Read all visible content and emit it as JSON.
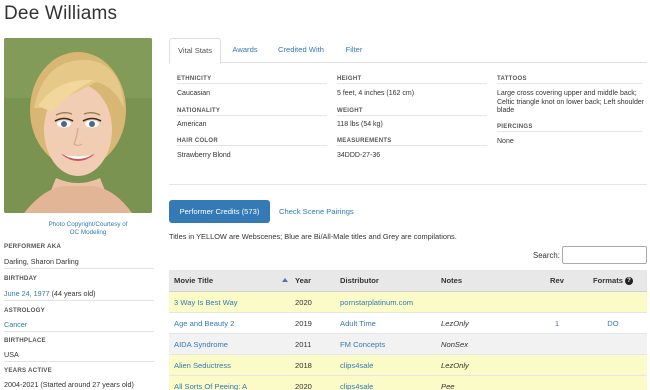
{
  "page": {
    "title": "Dee Williams"
  },
  "photo": {
    "credit_line1": "Photo Copyright/Courtesy of",
    "credit_line2": "OC Modeling"
  },
  "sidebar": [
    {
      "label": "PERFORMER AKA",
      "value": "Darling, Sharon Darling"
    },
    {
      "label": "BIRTHDAY",
      "value_link": "June 24, 1977",
      "value": " (44 years old)"
    },
    {
      "label": "ASTROLOGY",
      "value_link": "Cancer",
      "value": ""
    },
    {
      "label": "BIRTHPLACE",
      "value": "USA"
    },
    {
      "label": "YEARS ACTIVE",
      "value": "2004-2021 (Started around 27 years old)"
    }
  ],
  "tabs": [
    "Vital Stats",
    "Awards",
    "Credited With",
    "Filter"
  ],
  "stats": {
    "ethnicity": {
      "label": "ETHNICITY",
      "value": "Caucasian"
    },
    "nationality": {
      "label": "NATIONALITY",
      "value": "American"
    },
    "hair_color": {
      "label": "HAIR COLOR",
      "value": "Strawberry Blond"
    },
    "height": {
      "label": "HEIGHT",
      "value": "5 feet, 4 inches (162 cm)"
    },
    "weight": {
      "label": "WEIGHT",
      "value": "118 lbs (54 kg)"
    },
    "measurements": {
      "label": "MEASUREMENTS",
      "value": "34DDD-27-36"
    },
    "tattoos": {
      "label": "TATTOOS",
      "value": "Large cross covering upper and middle back; Celtic triangle knot on lower back; Left shoulder blade"
    },
    "piercings": {
      "label": "PIERCINGS",
      "value": "None"
    }
  },
  "credits": {
    "button": "Performer Credits (573)",
    "pairings": "Check Scene Pairings",
    "notice": "Titles in YELLOW are Webscenes; Blue are Bi/All-Male titles and Grey are compilations.",
    "search_label": "Search:",
    "search_value": ""
  },
  "table": {
    "headers": [
      "Movie Title",
      "Year",
      "Distributor",
      "Notes",
      "Rev",
      "Formats"
    ],
    "help_icon": "?",
    "rows": [
      {
        "title": "3 Way Is Best Way",
        "year": "2020",
        "distributor": "pornstarplatinum.com",
        "notes": "",
        "rev": "",
        "formats": "",
        "color": "yellow",
        "dist_link": true
      },
      {
        "title": "Age and Beauty 2",
        "year": "2019",
        "distributor": "Adult Time",
        "notes": "LezOnly",
        "rev": "1",
        "formats": "DO",
        "color": "white",
        "dist_link": true
      },
      {
        "title": "AIDA Syndrome",
        "year": "2011",
        "distributor": "FM Concepts",
        "notes": "NonSex",
        "rev": "",
        "formats": "",
        "color": "grey",
        "dist_link": true
      },
      {
        "title": "Alien Seductress",
        "year": "2018",
        "distributor": "clips4sale",
        "notes": "LezOnly",
        "rev": "",
        "formats": "",
        "color": "yellow",
        "dist_link": true
      },
      {
        "title": "All Sorts Of Peeing: A",
        "year": "2020",
        "distributor": "clips4sale",
        "notes": "Pee",
        "rev": "",
        "formats": "",
        "color": "yellow",
        "dist_link": true
      }
    ]
  }
}
